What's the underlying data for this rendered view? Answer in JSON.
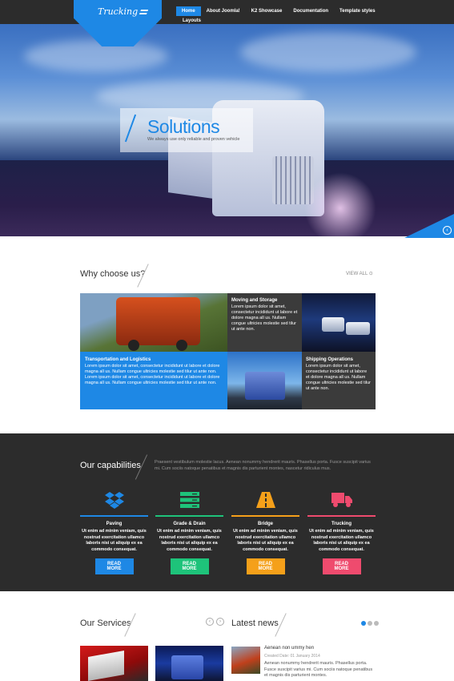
{
  "logo": {
    "text": "Trucking"
  },
  "nav": {
    "items": [
      "Home",
      "About Joomla!",
      "K2 Showcase",
      "Documentation",
      "Template styles"
    ],
    "sub": "Layouts"
  },
  "hero": {
    "title": "Solutions",
    "subtitle": "We always use only reliable and proven vehicle"
  },
  "why": {
    "title": "Why choose us?",
    "view_all": "VIEW ALL",
    "moving": {
      "title": "Moving and Storage",
      "text": "Lorem ipsum dolor sit amet, consectetur incididunt ut labore et dolore magna all us. Nullam congue ultricies molestie sed tilur ut ante non."
    },
    "transport": {
      "title": "Transportation and Logistics",
      "text": "Lorem ipsum dolor sit amet, consectetur incididunt ut labore et dolore magna all us. Nullam congue ultricies molestie sed tilur ut ante non. Lorem ipsum dolor sit amet, consectetur incididunt ut labore et dolore magna all us. Nullam congue ultricies molestie sed tilur ut ante non."
    },
    "shipping": {
      "title": "Shipping Operations",
      "text": "Lorem ipsum dolor sit amet, consectetur incididunt ut labore et dolore magna all us. Nullam congue ultricies molestie sed tilur ut ante non."
    }
  },
  "capabilities": {
    "title": "Our capabilities",
    "description": "Praesent vestibulum molestie lacus. Aenean nonummy hendrerit mauris. Phasellus porta. Fusce suscipit varius mi. Cum sociis natoque penatibus et magnis dis parturient montes, nascetur ridiculus mus.",
    "items": [
      {
        "name": "Paving",
        "text": "Ut enim ad minim veniam, quis nostrud exercitation ullamco laboris nisi ut aliquip ex ea commodo consequat.",
        "button": "READ MORE",
        "color": "#1e88e5",
        "icon": "dropbox-icon"
      },
      {
        "name": "Grade & Drain",
        "text": "Ut enim ad minim veniam, quis nostrud exercitation ullamco laboris nisi ut aliquip ex ea commodo consequat.",
        "button": "READ MORE",
        "color": "#1ec37a",
        "icon": "server-icon"
      },
      {
        "name": "Bridge",
        "text": "Ut enim ad minim veniam, quis nostrud exercitation ullamco laboris nisi ut aliquip ex ea commodo consequat.",
        "button": "READ MORE",
        "color": "#f5a01a",
        "icon": "road-icon"
      },
      {
        "name": "Trucking",
        "text": "Ut enim ad minim veniam, quis nostrud exercitation ullamco laboris nisi ut aliquip ex ea commodo consequat.",
        "button": "READ MORE",
        "color": "#ef4b6e",
        "icon": "truck-icon"
      }
    ]
  },
  "services": {
    "title": "Our Services"
  },
  "news": {
    "title": "Latest news",
    "item_title": "Aenean non ummy hen",
    "item_date": "Created Date: 01 January 2014",
    "item_text": "Aenean nonummy hendrerit mauris. Phasellus porta. Fusce suscipit varius mi. Cum sociis natoque penatibus et magnis dis parturient montes."
  },
  "colors": {
    "accent": "#1e88e5",
    "dark": "#2c2c2c"
  }
}
